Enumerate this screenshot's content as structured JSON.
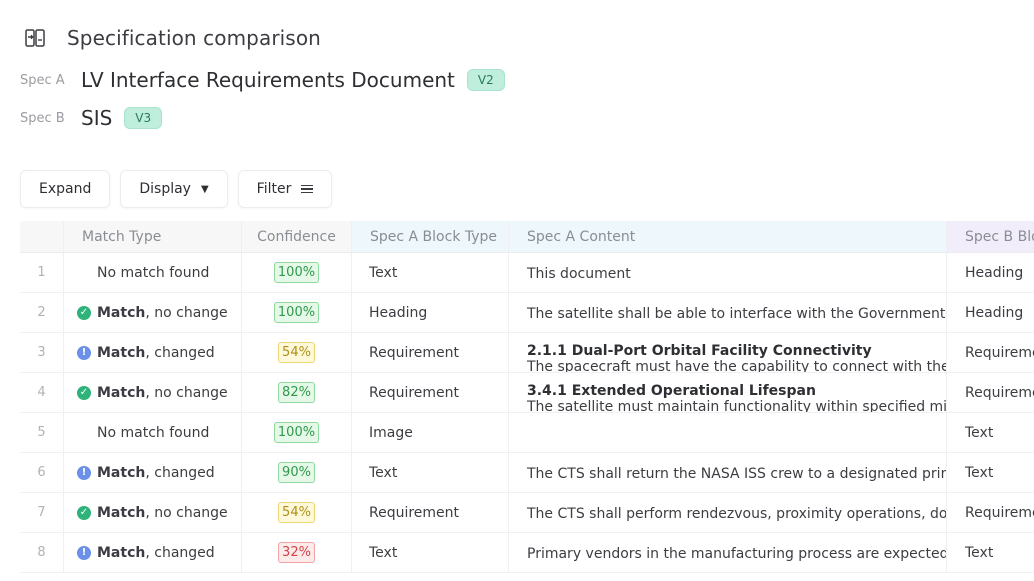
{
  "header": {
    "title": "Specification comparison",
    "icon": "compare-icon"
  },
  "spec_a": {
    "label": "Spec A",
    "name": "LV Interface Requirements Document",
    "version": "V2"
  },
  "spec_b": {
    "label": "Spec B",
    "name": "SIS",
    "version": "V3"
  },
  "toolbar": {
    "expand_label": "Expand",
    "display_label": "Display",
    "filter_label": "Filter"
  },
  "table": {
    "columns": {
      "match_type": "Match Type",
      "confidence": "Confidence",
      "spec_a_block_type": "Spec A Block Type",
      "spec_a_content": "Spec A Content",
      "spec_b_block_type": "Spec B Blo"
    },
    "rows": [
      {
        "num": "1",
        "match_strong": "",
        "match_rest": "No match found",
        "status": "none",
        "confidence": "100%",
        "conf_level": "green",
        "a_type": "Text",
        "a_title": "",
        "a_content": "This document",
        "b_type": "Heading"
      },
      {
        "num": "2",
        "match_strong": "Match",
        "match_rest": ", no change",
        "status": "ok",
        "confidence": "100%",
        "conf_level": "green",
        "a_type": "Heading",
        "a_title": "",
        "a_content": "The satellite shall be able to interface with the Government space",
        "b_type": "Heading"
      },
      {
        "num": "3",
        "match_strong": "Match",
        "match_rest": ", changed",
        "status": "info",
        "confidence": "54%",
        "conf_level": "yellow",
        "a_type": "Requirement",
        "a_title": "2.1.1 Dual-Port Orbital Facility Connectivity",
        "a_content": "The spacecraft must have the capability to connect with the station",
        "b_type": "Requirement"
      },
      {
        "num": "4",
        "match_strong": "Match",
        "match_rest": ", no change",
        "status": "ok",
        "confidence": "82%",
        "conf_level": "green",
        "a_type": "Requirement",
        "a_title": "3.4.1 Extended Operational Lifespan",
        "a_content": "The satellite must maintain functionality within specified mission",
        "b_type": "Requirement"
      },
      {
        "num": "5",
        "match_strong": "",
        "match_rest": "No match found",
        "status": "none",
        "confidence": "100%",
        "conf_level": "green",
        "a_type": "Image",
        "a_title": "",
        "a_content": "",
        "b_type": "Text"
      },
      {
        "num": "6",
        "match_strong": "Match",
        "match_rest": ", changed",
        "status": "info",
        "confidence": "90%",
        "conf_level": "green",
        "a_type": "Text",
        "a_title": "",
        "a_content": "The CTS shall return the NASA ISS crew to a designated primary",
        "b_type": "Text"
      },
      {
        "num": "7",
        "match_strong": "Match",
        "match_rest": ", no change",
        "status": "ok",
        "confidence": "54%",
        "conf_level": "yellow",
        "a_type": "Requirement",
        "a_title": "",
        "a_content": "The CTS shall perform rendezvous, proximity operations, docking",
        "b_type": "Requirement"
      },
      {
        "num": "8",
        "match_strong": "Match",
        "match_rest": ", changed",
        "status": "info",
        "confidence": "32%",
        "conf_level": "red",
        "a_type": "Text",
        "a_title": "",
        "a_content": "Primary vendors in the manufacturing process are expected to be",
        "b_type": "Text"
      }
    ]
  }
}
